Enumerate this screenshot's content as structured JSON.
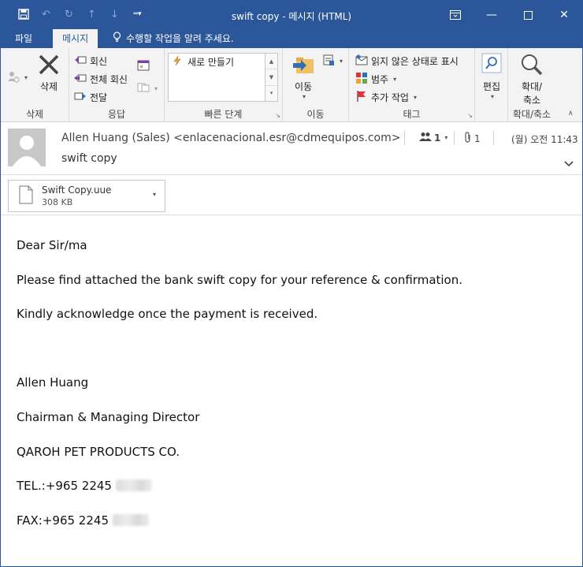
{
  "window": {
    "title": "swift copy - 메시지 (HTML)",
    "controls": [
      "ribbon-display-options",
      "minimize",
      "maximize",
      "close"
    ]
  },
  "tabs": {
    "file": "파일",
    "message": "메시지",
    "tell_me": "수행할 작업을 알려 주세요."
  },
  "ribbon": {
    "delete": {
      "label": "삭제",
      "group": "삭제"
    },
    "respond": {
      "reply": "회신",
      "reply_all": "전체 회신",
      "forward": "전달",
      "group": "응답"
    },
    "quick_steps": {
      "item": "새로 만들기",
      "group": "빠른 단계"
    },
    "move": {
      "label": "이동",
      "group": "이동"
    },
    "tags": {
      "mark_unread": "읽지 않은 상태로 표시",
      "categorize": "범주",
      "follow_up": "추가 작업",
      "group": "태그"
    },
    "editing": {
      "label": "편집"
    },
    "zoom": {
      "label_line1": "확대/",
      "label_line2": "축소",
      "group": "확대/축소"
    }
  },
  "header": {
    "sender": "Allen Huang (Sales) <enlacenacional.esr@cdmequipos.com>",
    "subject": "swift copy",
    "people_count": "1",
    "attachment_count": "1",
    "datetime": "(월) 오전 11:43"
  },
  "attachment": {
    "name": "Swift Copy.uue",
    "size": "308 KB"
  },
  "body": {
    "greeting": "Dear Sir/ma",
    "line1": "Please find attached the bank swift copy for your reference & confirmation.",
    "line2": "Kindly acknowledge once the payment is received.",
    "sig_name": "Allen Huang",
    "sig_title": "Chairman & Managing Director",
    "sig_company": "QAROH PET PRODUCTS CO.",
    "sig_tel": "TEL.:+965 2245",
    "sig_fax": "FAX:+965 2245"
  },
  "colors": {
    "accent": "#2b579a",
    "ribbon_bg": "#f3f3f3"
  }
}
